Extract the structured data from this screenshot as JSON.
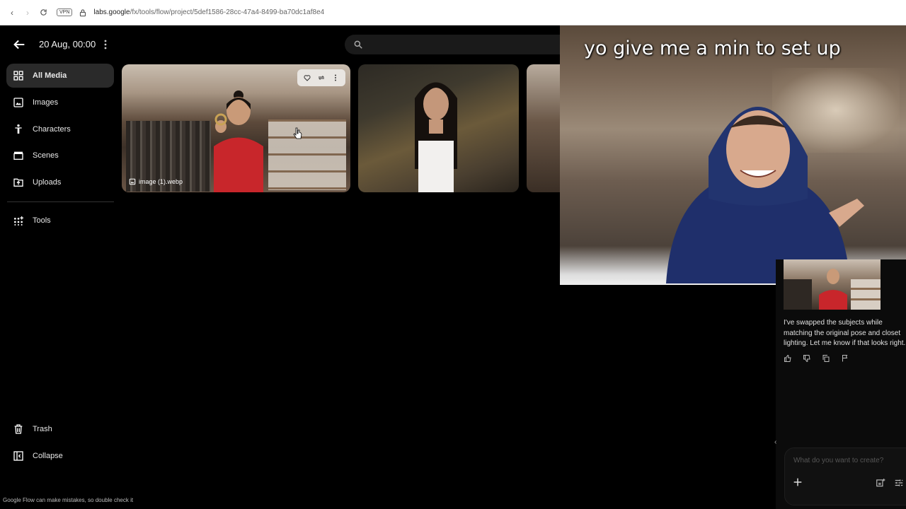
{
  "browser": {
    "vpn": "VPN",
    "url_domain": "labs.google",
    "url_path": "/fx/tools/flow/project/5def1586-28cc-47a4-8499-ba70dc1af8e4"
  },
  "header": {
    "title": "20 Aug, 00:00",
    "search_placeholder": ""
  },
  "sidebar": {
    "items": [
      {
        "label": "All Media",
        "icon": "grid-icon",
        "active": true
      },
      {
        "label": "Images",
        "icon": "image-icon"
      },
      {
        "label": "Characters",
        "icon": "person-icon"
      },
      {
        "label": "Scenes",
        "icon": "clapper-icon"
      },
      {
        "label": "Uploads",
        "icon": "upload-folder-icon"
      },
      {
        "label": "Tools",
        "icon": "tools-grid-icon"
      }
    ],
    "bottom": [
      {
        "label": "Trash",
        "icon": "trash-icon"
      },
      {
        "label": "Collapse",
        "icon": "collapse-icon"
      }
    ]
  },
  "media": {
    "tiles": [
      {
        "label": "image (1).webp"
      }
    ]
  },
  "overlay": {
    "caption": "yo give me a min to set up"
  },
  "chat": {
    "message": "I've swapped the subjects while matching the original pose and closet lighting. Let me know if that looks right.",
    "prompt_placeholder": "What do you want to create?"
  },
  "footer": {
    "disclaimer": "Google Flow can make mistakes, so double check it"
  },
  "colors": {
    "background": "#000000",
    "active_item": "#2a2a2a",
    "search_bg": "#1a1a1a"
  }
}
